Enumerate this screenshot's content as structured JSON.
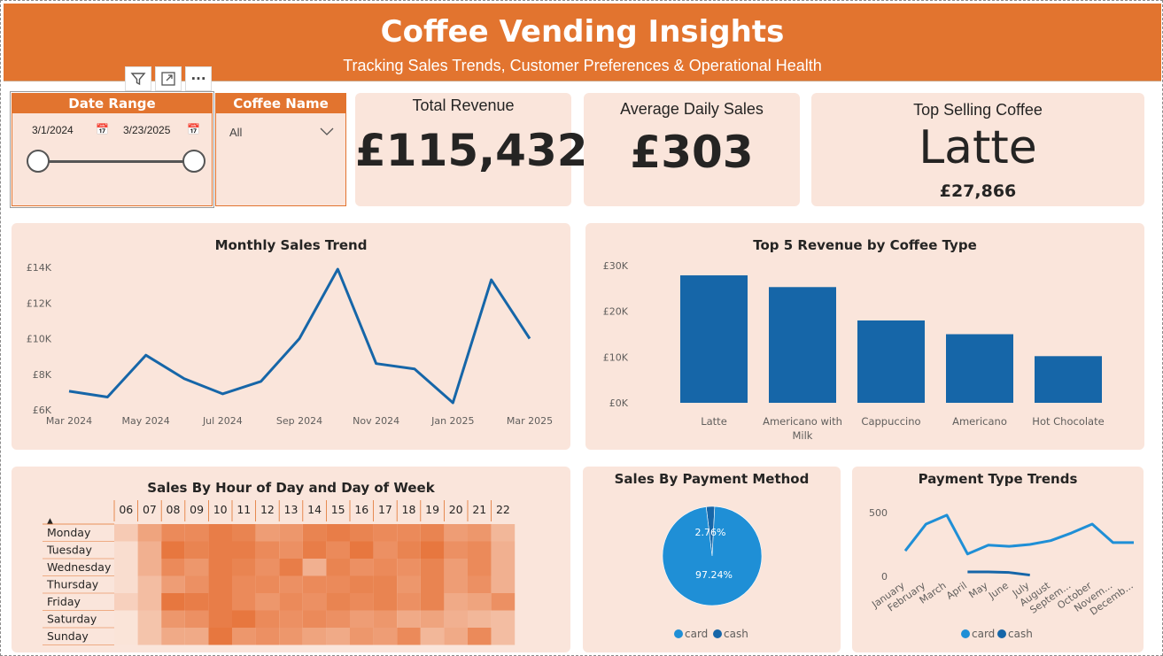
{
  "header": {
    "title": "Coffee Vending Insights",
    "subtitle": "Tracking Sales Trends, Customer Preferences & Operational Health"
  },
  "colors": {
    "accent": "#E2742F",
    "card_bg": "#FAE5DB",
    "series_blue": "#1666A8",
    "series_light_blue": "#1F8FD6"
  },
  "visual_toolbar": {
    "icons": [
      "filter-icon",
      "focus-mode-icon",
      "more-options-icon"
    ],
    "more_label": "···"
  },
  "date_slicer": {
    "title": "Date Range",
    "start": "3/1/2024",
    "end": "3/23/2025"
  },
  "coffee_slicer": {
    "title": "Coffee Name",
    "selected": "All"
  },
  "kpis": {
    "total_revenue": {
      "label": "Total Revenue",
      "value": "£115,432"
    },
    "avg_daily_sales": {
      "label": "Average Daily Sales",
      "value": "£303"
    },
    "top_selling": {
      "label": "Top Selling Coffee",
      "value": "Latte",
      "sub_value": "£27,866"
    }
  },
  "chart_data": [
    {
      "id": "monthly_sales",
      "type": "line",
      "title": "Monthly Sales Trend",
      "x_tick_labels": [
        "Mar 2024",
        "May 2024",
        "Jul 2024",
        "Sep 2024",
        "Nov 2024",
        "Jan 2025",
        "Mar 2025"
      ],
      "x": [
        "Mar 2024",
        "Apr 2024",
        "May 2024",
        "Jun 2024",
        "Jul 2024",
        "Aug 2024",
        "Sep 2024",
        "Oct 2024",
        "Nov 2024",
        "Dec 2024",
        "Jan 2025",
        "Feb 2025",
        "Mar 2025"
      ],
      "values": [
        7050,
        6720,
        9070,
        7750,
        6900,
        7600,
        10000,
        13900,
        8600,
        8300,
        6400,
        13300,
        10000
      ],
      "ylim": [
        6000,
        14000
      ],
      "y_ticks": [
        6000,
        8000,
        10000,
        12000,
        14000
      ],
      "y_tick_labels": [
        "£6K",
        "£8K",
        "£10K",
        "£12K",
        "£14K"
      ],
      "color": "#1666A8"
    },
    {
      "id": "top5_coffee",
      "type": "bar",
      "title": "Top 5 Revenue by Coffee Type",
      "categories": [
        "Latte",
        "Americano with Milk",
        "Cappuccino",
        "Americano",
        "Hot Chocolate"
      ],
      "values": [
        27866,
        25300,
        18000,
        15000,
        10200
      ],
      "ylim": [
        0,
        30000
      ],
      "y_ticks": [
        0,
        10000,
        20000,
        30000
      ],
      "y_tick_labels": [
        "£0K",
        "£10K",
        "£20K",
        "£30K"
      ],
      "color": "#1666A8"
    },
    {
      "id": "hour_day_heatmap",
      "type": "heatmap",
      "title": "Sales By Hour of Day and Day of Week",
      "x": [
        "06",
        "07",
        "08",
        "09",
        "10",
        "11",
        "12",
        "13",
        "14",
        "15",
        "16",
        "17",
        "18",
        "19",
        "20",
        "21",
        "22"
      ],
      "y": [
        "Monday",
        "Tuesday",
        "Wednesday",
        "Thursday",
        "Friday",
        "Saturday",
        "Sunday"
      ],
      "values": [
        [
          0.25,
          0.55,
          0.75,
          0.75,
          0.85,
          0.8,
          0.6,
          0.65,
          0.8,
          0.85,
          0.8,
          0.75,
          0.75,
          0.8,
          0.6,
          0.65,
          0.4
        ],
        [
          0.1,
          0.45,
          0.9,
          0.8,
          0.85,
          0.85,
          0.75,
          0.7,
          0.85,
          0.75,
          0.9,
          0.7,
          0.8,
          0.9,
          0.7,
          0.75,
          0.45
        ],
        [
          0.1,
          0.45,
          0.75,
          0.65,
          0.85,
          0.8,
          0.7,
          0.85,
          0.45,
          0.8,
          0.7,
          0.75,
          0.7,
          0.8,
          0.6,
          0.75,
          0.45
        ],
        [
          0.1,
          0.35,
          0.6,
          0.7,
          0.85,
          0.75,
          0.75,
          0.7,
          0.75,
          0.75,
          0.8,
          0.8,
          0.65,
          0.8,
          0.6,
          0.7,
          0.45
        ],
        [
          0.2,
          0.35,
          0.9,
          0.85,
          0.85,
          0.75,
          0.65,
          0.75,
          0.7,
          0.8,
          0.75,
          0.8,
          0.7,
          0.8,
          0.5,
          0.55,
          0.7
        ],
        [
          0.05,
          0.3,
          0.65,
          0.7,
          0.85,
          0.9,
          0.75,
          0.7,
          0.75,
          0.7,
          0.6,
          0.65,
          0.5,
          0.55,
          0.45,
          0.4,
          0.35
        ],
        [
          0.05,
          0.3,
          0.5,
          0.5,
          0.9,
          0.65,
          0.7,
          0.65,
          0.55,
          0.5,
          0.65,
          0.6,
          0.75,
          0.4,
          0.5,
          0.75,
          0.35
        ]
      ],
      "sort_indicator": "▲"
    },
    {
      "id": "payment_pie",
      "type": "pie",
      "title": "Sales By Payment Method",
      "categories": [
        "card",
        "cash"
      ],
      "values": [
        97.24,
        2.76
      ],
      "labels": [
        "97.24%",
        "2.76%"
      ],
      "colors": [
        "#1F8FD6",
        "#1666A8"
      ],
      "legend": [
        "card",
        "cash"
      ]
    },
    {
      "id": "payment_trends",
      "type": "line",
      "title": "Payment Type Trends",
      "categories": [
        "January",
        "February",
        "March",
        "April",
        "May",
        "June",
        "July",
        "August",
        "Septem...",
        "October",
        "Novem...",
        "Decemb..."
      ],
      "series": [
        {
          "name": "card",
          "values": [
            200,
            410,
            480,
            175,
            245,
            235,
            250,
            280,
            340,
            410,
            265,
            265
          ],
          "color": "#1F8FD6"
        },
        {
          "name": "cash",
          "values": [
            null,
            null,
            null,
            35,
            35,
            30,
            10,
            null,
            null,
            null,
            null,
            null
          ],
          "color": "#1666A8"
        }
      ],
      "y_ticks": [
        0,
        500
      ],
      "y_tick_labels": [
        "0",
        "500"
      ],
      "ylim": [
        0,
        500
      ],
      "legend": [
        "card",
        "cash"
      ]
    }
  ]
}
